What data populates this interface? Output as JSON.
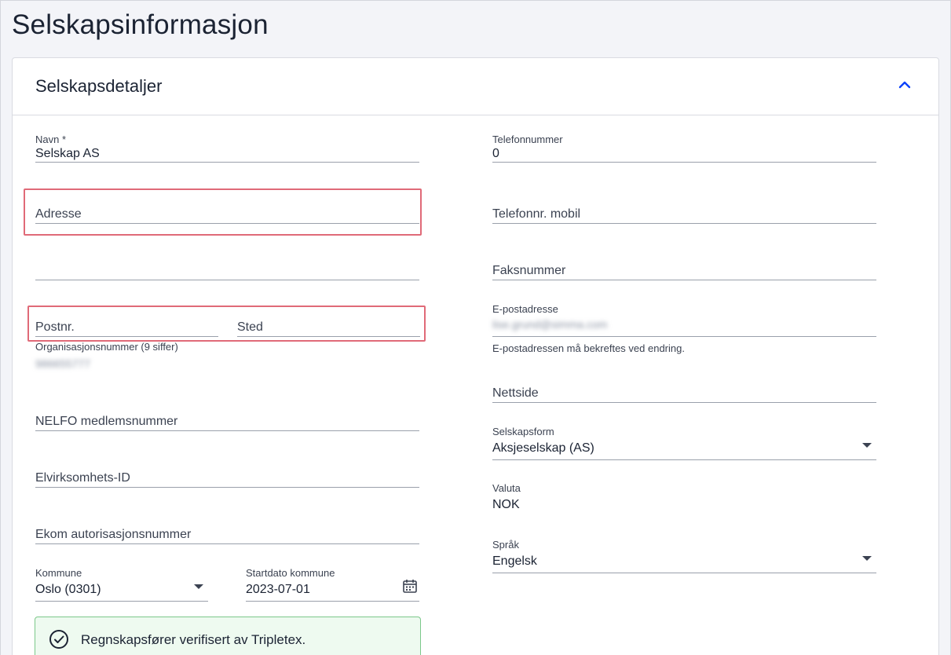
{
  "page": {
    "title": "Selskapsinformasjon"
  },
  "section": {
    "title": "Selskapsdetaljer"
  },
  "left": {
    "name": {
      "label": "Navn *",
      "value": "Selskap AS"
    },
    "address1": {
      "placeholder": "Adresse"
    },
    "address2": {
      "placeholder": ""
    },
    "postal_code": {
      "placeholder": "Postnr."
    },
    "city": {
      "placeholder": "Sted"
    },
    "org_number": {
      "label": "Organisasjonsnummer (9 siffer)",
      "value": "986655777"
    },
    "nelfo": {
      "placeholder": "NELFO medlemsnummer"
    },
    "elvirksomhet": {
      "placeholder": "Elvirksomhets-ID"
    },
    "ekom": {
      "placeholder": "Ekom autorisasjonsnummer"
    },
    "municipality": {
      "label": "Kommune",
      "value": "Oslo (0301)"
    },
    "municipality_start": {
      "label": "Startdato kommune",
      "value": "2023-07-01"
    }
  },
  "right": {
    "phone": {
      "label": "Telefonnummer",
      "value": "0"
    },
    "mobile": {
      "placeholder": "Telefonnr. mobil"
    },
    "fax": {
      "placeholder": "Faksnummer"
    },
    "email": {
      "label": "E-postadresse",
      "value": "lise.grund@simma.com",
      "helper": "E-postadressen må bekreftes ved endring."
    },
    "website": {
      "placeholder": "Nettside"
    },
    "company_form": {
      "label": "Selskapsform",
      "value": "Aksjeselskap (AS)"
    },
    "currency": {
      "label": "Valuta",
      "value": "NOK"
    },
    "language": {
      "label": "Språk",
      "value": "Engelsk"
    }
  },
  "verified": {
    "text": "Regnskapsfører verifisert av Tripletex."
  },
  "colors": {
    "accent": "#0a41fa",
    "highlight": "#e06a78",
    "success": "#2e7d3c"
  },
  "icons": {
    "collapse": "chevron-up-icon",
    "calendar": "calendar-icon",
    "check": "check-circle-icon"
  }
}
